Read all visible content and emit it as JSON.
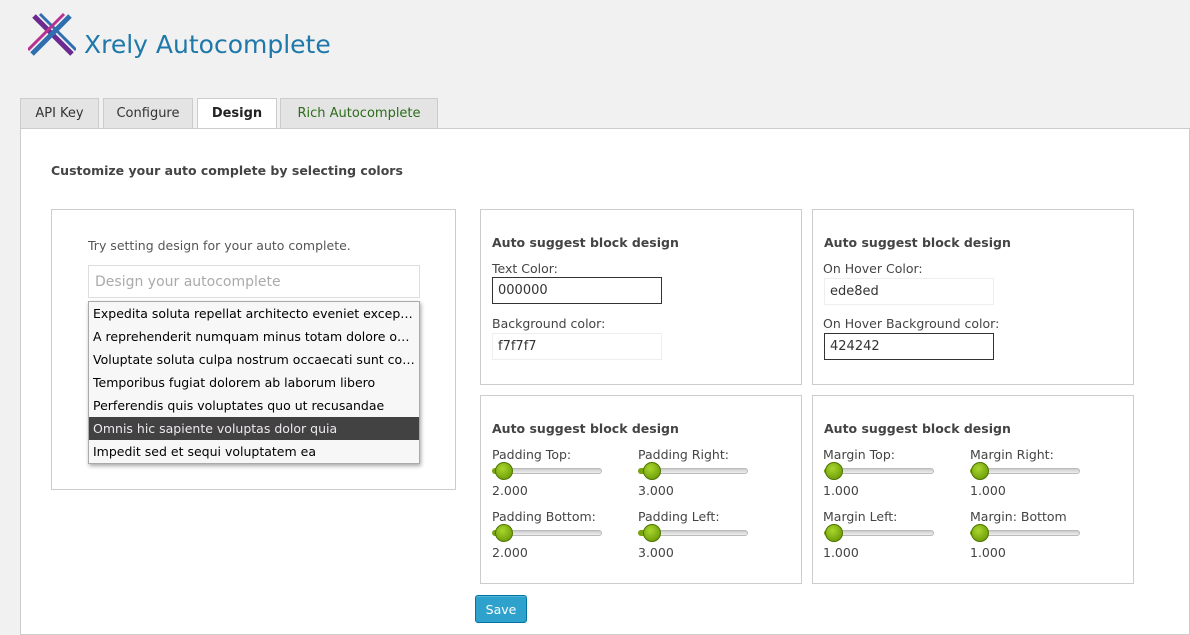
{
  "header": {
    "title": "Xrely Autocomplete"
  },
  "tabs": [
    {
      "label": "API Key"
    },
    {
      "label": "Configure"
    },
    {
      "label": "Design"
    },
    {
      "label": "Rich Autocomplete"
    }
  ],
  "panel": {
    "intro": "Customize your auto complete by selecting colors"
  },
  "preview": {
    "hint": "Try setting design for your auto complete.",
    "placeholder": "Design your autocomplete",
    "suggestions": [
      "Expedita soluta repellat architecto eveniet exceptur...",
      "A reprehenderit numquam minus totam dolore offi...",
      "Voluptate soluta culpa nostrum occaecati sunt cons...",
      "Temporibus fugiat dolorem ab laborum libero",
      "Perferendis quis voluptates quo ut recusandae",
      "Omnis hic sapiente voluptas dolor quia",
      "Impedit sed et sequi voluptatem ea"
    ]
  },
  "colors_card": {
    "title": "Auto suggest block design",
    "text_color_label": "Text Color:",
    "text_color_value": "000000",
    "bg_color_label": "Background color:",
    "bg_color_value": "f7f7f7"
  },
  "hover_card": {
    "title": "Auto suggest block design",
    "hover_color_label": "On Hover Color:",
    "hover_color_value": "ede8ed",
    "hover_bg_label": "On Hover Background color:",
    "hover_bg_value": "424242"
  },
  "padding_card": {
    "title": "Auto suggest block design",
    "top_label": "Padding Top:",
    "top_value": "2.000",
    "right_label": "Padding Right:",
    "right_value": "3.000",
    "bottom_label": "Padding Bottom:",
    "bottom_value": "2.000",
    "left_label": "Padding Left:",
    "left_value": "3.000"
  },
  "margin_card": {
    "title": "Auto suggest block design",
    "top_label": "Margin Top:",
    "top_value": "1.000",
    "right_label": "Margin Right:",
    "right_value": "1.000",
    "left_label": "Margin Left:",
    "left_value": "1.000",
    "bottom_label": "Margin: Bottom",
    "bottom_value": "1.000"
  },
  "actions": {
    "save_label": "Save"
  },
  "theme": {
    "accent": "#2ea2cc",
    "title_color": "#1e78a9",
    "slider_green": "#7aa310",
    "hover_bg": "#424242",
    "hover_text": "#ede8ed"
  },
  "icons": {
    "logo": "x-logo-icon"
  }
}
